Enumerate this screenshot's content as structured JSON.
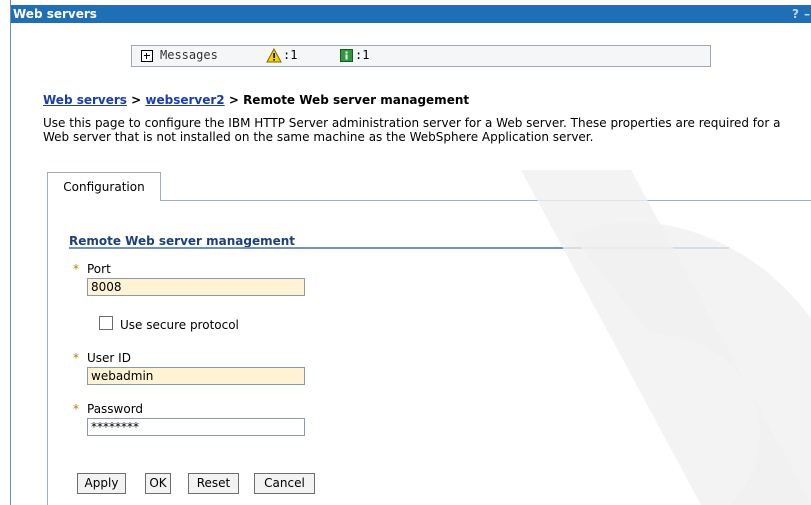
{
  "window": {
    "title": "Web servers",
    "help_glyph": "?",
    "minimize_glyph": "–"
  },
  "messages": {
    "label": "Messages",
    "warning_count": ":1",
    "info_count": ":1"
  },
  "breadcrumb": {
    "items": [
      "Web servers",
      "webserver2"
    ],
    "separator": ">",
    "current": "Remote Web server management"
  },
  "description": "Use this page to configure the IBM HTTP Server administration server for a Web server. These properties are required for a Web server that is not installed on the same machine as the WebSphere Application server.",
  "tabs": [
    {
      "label": "Configuration",
      "active": true
    }
  ],
  "form": {
    "section_title": "Remote Web server management",
    "required_marker": "*",
    "port": {
      "label": "Port",
      "value": "8008"
    },
    "secure_protocol": {
      "label": "Use secure protocol",
      "checked": false
    },
    "user_id": {
      "label": "User ID",
      "value": "webadmin"
    },
    "password": {
      "label": "Password",
      "value": "********"
    }
  },
  "buttons": {
    "apply": "Apply",
    "ok": "OK",
    "reset": "Reset",
    "cancel": "Cancel"
  },
  "colors": {
    "titlebar": "#1f6fb6",
    "link": "#1a3cb0",
    "required_field": "#fff3d6",
    "section_rule": "#6f93c2"
  }
}
